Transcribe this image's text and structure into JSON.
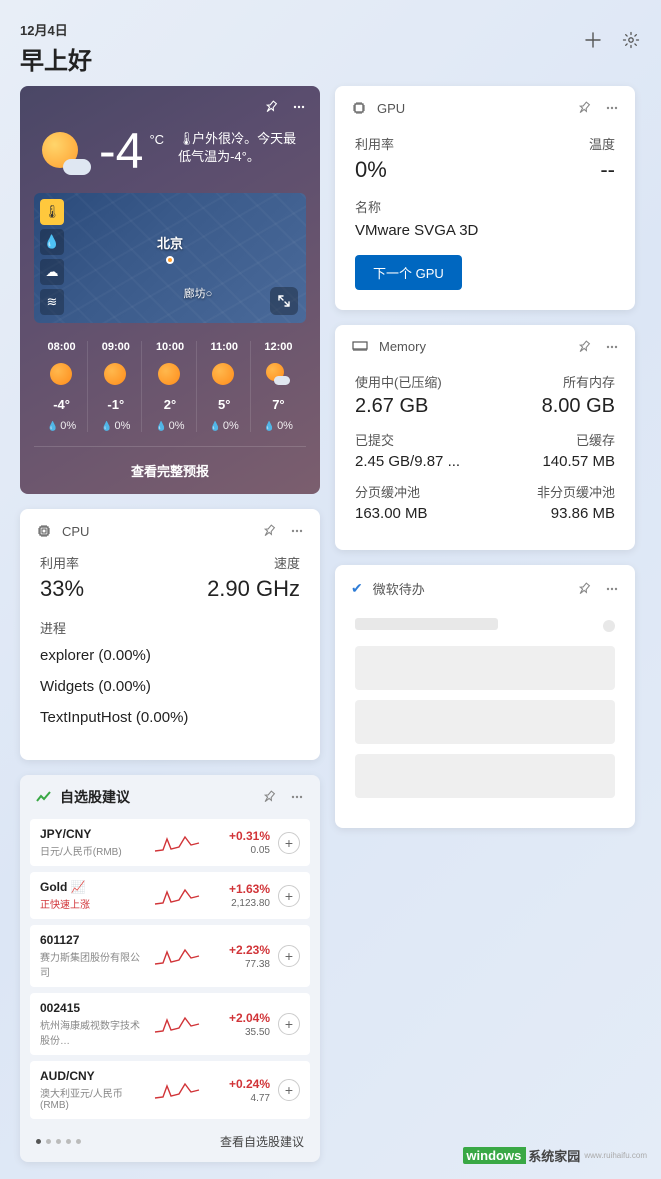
{
  "header": {
    "date": "12月4日",
    "greeting": "早上好"
  },
  "weather": {
    "temp": "-4",
    "unit": "°C",
    "desc": "户外很冷。今天最低气温为-4°。",
    "city_main": "北京",
    "city_sub": "廊坊○",
    "forecast": [
      {
        "time": "08:00",
        "temp": "-4°",
        "precip": "0%",
        "icon": "sun"
      },
      {
        "time": "09:00",
        "temp": "-1°",
        "precip": "0%",
        "icon": "sun"
      },
      {
        "time": "10:00",
        "temp": "2°",
        "precip": "0%",
        "icon": "sun"
      },
      {
        "time": "11:00",
        "temp": "5°",
        "precip": "0%",
        "icon": "sun"
      },
      {
        "time": "12:00",
        "temp": "7°",
        "precip": "0%",
        "icon": "partly"
      }
    ],
    "view_full": "查看完整预报"
  },
  "cpu": {
    "title": "CPU",
    "util_label": "利用率",
    "util_value": "33%",
    "speed_label": "速度",
    "speed_value": "2.90 GHz",
    "proc_label": "进程",
    "processes": [
      "explorer (0.00%)",
      "Widgets (0.00%)",
      "TextInputHost (0.00%)"
    ]
  },
  "stocks": {
    "title": "自选股建议",
    "items": [
      {
        "symbol": "JPY/CNY",
        "name": "日元/人民币(RMB)",
        "change": "+0.31%",
        "price": "0.05",
        "nameClass": ""
      },
      {
        "symbol": "Gold 📈",
        "name": "正快速上涨",
        "change": "+1.63%",
        "price": "2,123.80",
        "nameClass": "red"
      },
      {
        "symbol": "601127",
        "name": "赛力斯集团股份有限公司",
        "change": "+2.23%",
        "price": "77.38",
        "nameClass": ""
      },
      {
        "symbol": "002415",
        "name": "杭州海康威视数字技术股份…",
        "change": "+2.04%",
        "price": "35.50",
        "nameClass": ""
      },
      {
        "symbol": "AUD/CNY",
        "name": "澳大利亚元/人民币(RMB)",
        "change": "+0.24%",
        "price": "4.77",
        "nameClass": ""
      }
    ],
    "view_link": "查看自选股建议"
  },
  "gpu": {
    "title": "GPU",
    "util_label": "利用率",
    "util_value": "0%",
    "temp_label": "温度",
    "temp_value": "--",
    "name_label": "名称",
    "name_value": "VMware SVGA 3D",
    "next_btn": "下一个 GPU"
  },
  "memory": {
    "title": "Memory",
    "used_label": "使用中(已压缩)",
    "used_value": "2.67 GB",
    "total_label": "所有内存",
    "total_value": "8.00 GB",
    "commit_label": "已提交",
    "commit_value": "2.45 GB/9.87 ...",
    "cached_label": "已缓存",
    "cached_value": "140.57 MB",
    "paged_label": "分页缓冲池",
    "paged_value": "163.00 MB",
    "nonpaged_label": "非分页缓冲池",
    "nonpaged_value": "93.86 MB"
  },
  "todo": {
    "title": "微软待办"
  },
  "watermark": {
    "brand": "windows",
    "text": "系统家园",
    "url": "www.ruihaifu.com"
  }
}
